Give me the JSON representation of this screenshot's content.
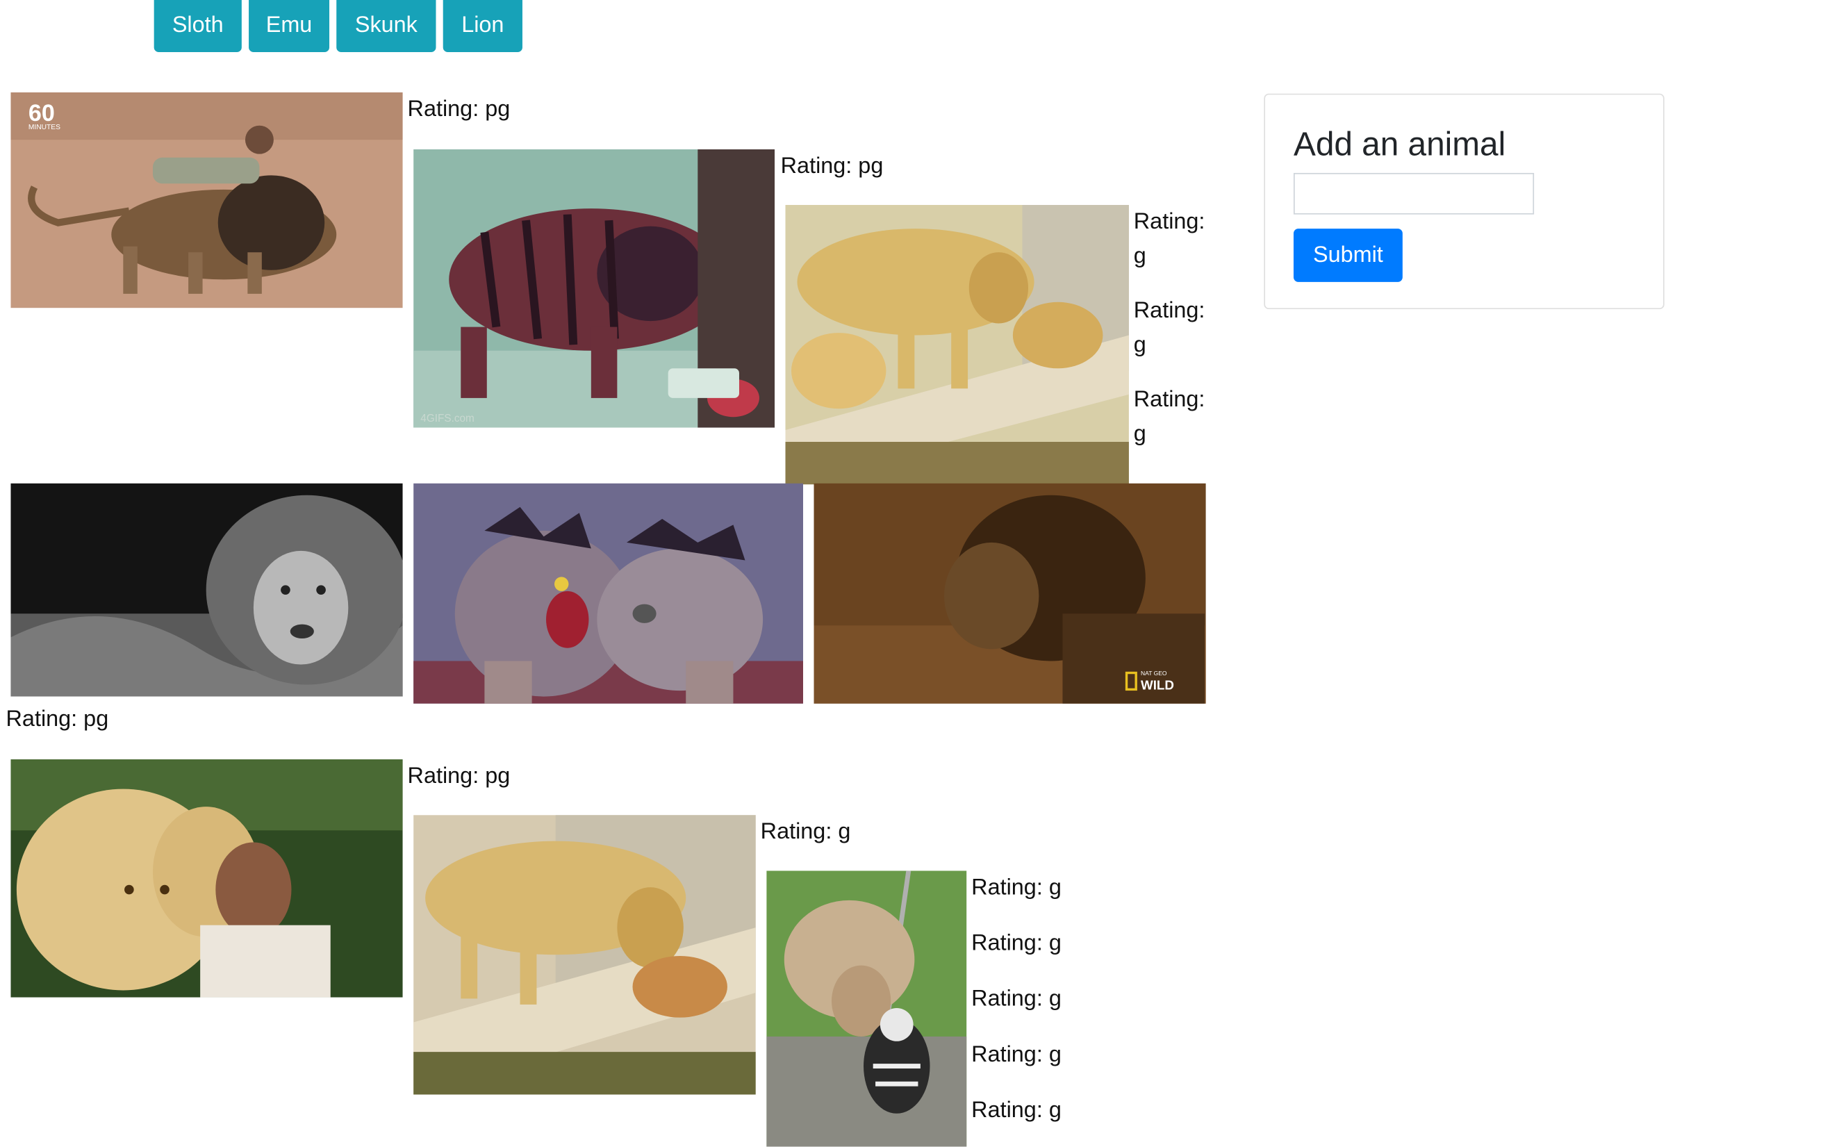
{
  "nav": {
    "buttons": [
      "Sloth",
      "Emu",
      "Skunk",
      "Lion"
    ]
  },
  "form": {
    "title": "Add an animal",
    "input_value": "",
    "submit_label": "Submit"
  },
  "ratings": [
    "Rating: pg",
    "Rating: pg",
    "Rating: g",
    "Rating: g",
    "Rating: g",
    "Rating: pg",
    "Rating: pg",
    "Rating: g",
    "Rating: g",
    "Rating: g",
    "Rating: g",
    "Rating: g",
    "Rating: g"
  ],
  "image_marks": {
    "sixty_minutes": "60",
    "sixty_minutes_sub": "MINUTES",
    "fourgifs": "4GIFS.com",
    "natgeo_small": "NAT GEO",
    "natgeo": "WILD"
  },
  "colors": {
    "nav_button": "#17a2b8",
    "submit_button": "#007bff"
  }
}
